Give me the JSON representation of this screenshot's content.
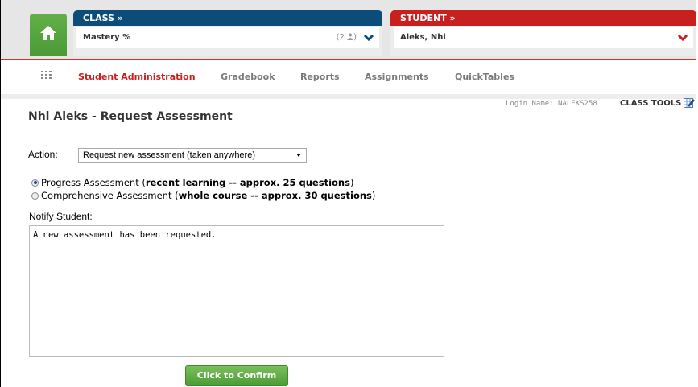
{
  "header": {
    "class_label": "CLASS »",
    "class_value": "Mastery %",
    "class_count": "(2",
    "class_count_end": ")",
    "student_label": "STUDENT »",
    "student_value": "Aleks, Nhi"
  },
  "nav": {
    "items": [
      "Student Administration",
      "Gradebook",
      "Reports",
      "Assignments",
      "QuickTables"
    ],
    "active_color": "#c8201e"
  },
  "meta": {
    "login": "Login Name: NALEKS258",
    "class_tools": "CLASS TOOLS"
  },
  "page": {
    "title": "Nhi Aleks - Request Assessment",
    "action_label": "Action:",
    "action_value": "Request new assessment (taken anywhere)",
    "options": [
      {
        "pre": "Progress Assessment (",
        "bold": "recent learning -- approx. 25 questions",
        "post": ")",
        "selected": true
      },
      {
        "pre": "Comprehensive Assessment (",
        "bold": "whole course -- approx. 30 questions",
        "post": ")",
        "selected": false
      }
    ],
    "notify_label": "Notify Student:",
    "notify_text": "A new assessment has been requested.",
    "confirm_label": "Click to Confirm"
  },
  "colors": {
    "class_header": "#0c4c7a",
    "student_header": "#c8201e",
    "home": "#5aa640",
    "confirm": "#5aa640"
  }
}
